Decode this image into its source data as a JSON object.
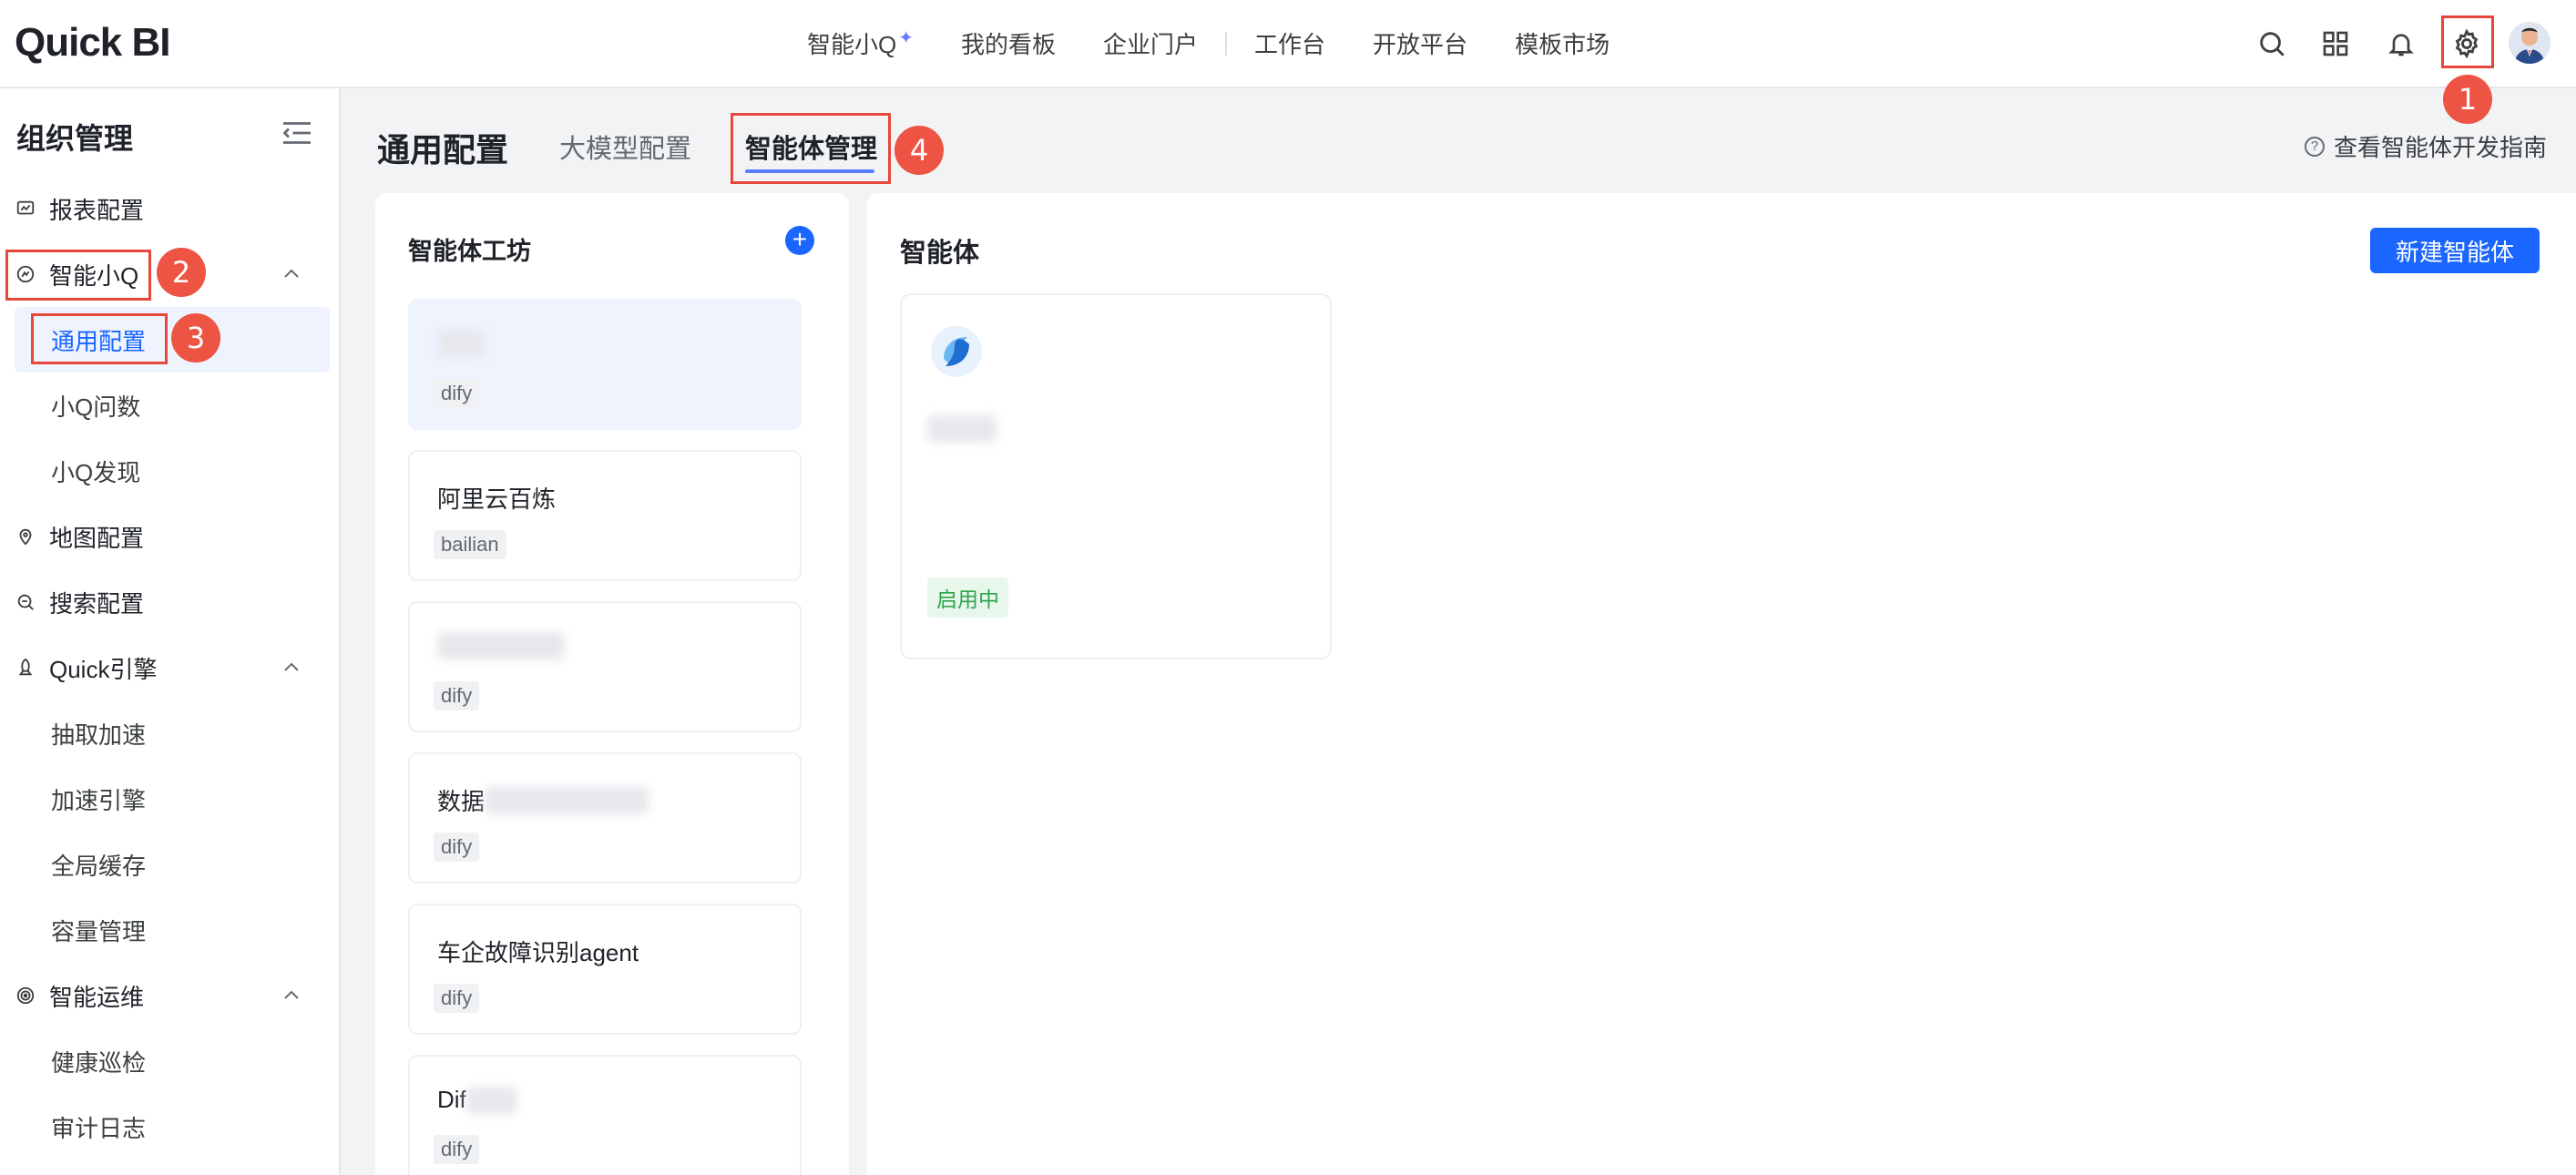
{
  "app": {
    "logo": "Quick BI"
  },
  "topnav": {
    "items": [
      {
        "label": "智能小Q"
      },
      {
        "label": "我的看板"
      },
      {
        "label": "企业门户"
      },
      {
        "label": "工作台"
      },
      {
        "label": "开放平台"
      },
      {
        "label": "模板市场"
      }
    ],
    "sparkle": "✦"
  },
  "toolbar_icons": [
    "search-icon",
    "apps-grid-icon",
    "bell-icon",
    "gear-icon",
    "avatar"
  ],
  "sidebar": {
    "title": "组织管理",
    "items": [
      {
        "label": "报表配置",
        "icon": "report-icon"
      },
      {
        "label": "智能小Q",
        "icon": "smart-q-icon",
        "expanded": true
      },
      {
        "label": "通用配置",
        "sub": true,
        "active": true
      },
      {
        "label": "小Q问数",
        "sub": true
      },
      {
        "label": "小Q发现",
        "sub": true
      },
      {
        "label": "地图配置",
        "icon": "map-pin-icon"
      },
      {
        "label": "搜索配置",
        "icon": "search-config-icon"
      },
      {
        "label": "Quick引擎",
        "icon": "rocket-icon",
        "expanded": true
      },
      {
        "label": "抽取加速",
        "sub": true
      },
      {
        "label": "加速引擎",
        "sub": true
      },
      {
        "label": "全局缓存",
        "sub": true
      },
      {
        "label": "容量管理",
        "sub": true
      },
      {
        "label": "智能运维",
        "icon": "target-icon",
        "expanded": true
      },
      {
        "label": "健康巡检",
        "sub": true
      },
      {
        "label": "审计日志",
        "sub": true
      }
    ]
  },
  "header": {
    "title": "通用配置",
    "tabs": [
      {
        "label": "大模型配置",
        "active": false
      },
      {
        "label": "智能体管理",
        "active": true
      }
    ],
    "guide_link": "查看智能体开发指南",
    "guide_icon": "?"
  },
  "workshop": {
    "title": "智能体工坊",
    "add_icon": "+",
    "cards": [
      {
        "name": "",
        "tag": "dify",
        "selected": true
      },
      {
        "name": "阿里云百炼",
        "tag": "bailian"
      },
      {
        "name": "",
        "tag": "dify"
      },
      {
        "name": "数据",
        "tag": "dify"
      },
      {
        "name": "车企故障识别agent",
        "tag": "dify"
      },
      {
        "name": "Dif",
        "tag": "dify"
      }
    ]
  },
  "agents": {
    "title": "智能体",
    "new_button": "新建智能体",
    "cards": [
      {
        "name": "",
        "status": "启用中",
        "status_color": "#2ea44f"
      }
    ]
  },
  "annotations": [
    "1",
    "2",
    "3",
    "4"
  ],
  "colors": {
    "primary": "#1a66ff",
    "annotation_red": "#e5483a",
    "active_bg": "#eef3fe"
  }
}
